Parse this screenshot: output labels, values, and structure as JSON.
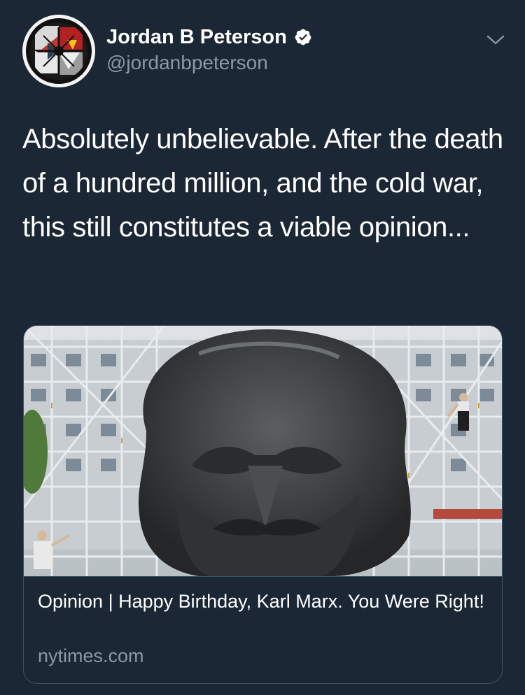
{
  "tweet": {
    "author": {
      "display_name": "Jordan B Peterson",
      "handle": "@jordanbpeterson",
      "verified": true,
      "avatar_icon": "abstract-geometric-avatar-icon"
    },
    "text": "Absolutely unbelievable. After the death of a hundred million, and the cold war, this still constitutes a viable opinion...",
    "menu_icon": "chevron-down-icon"
  },
  "card": {
    "image_alt": "Karl Marx monument head in front of scaffolding",
    "title": "Opinion | Happy Birthday, Karl Marx. You Were Right!",
    "domain": "nytimes.com"
  },
  "colors": {
    "background": "#1b2735",
    "text_primary": "#ffffff",
    "text_secondary": "#8899a6",
    "card_border": "#3d5366",
    "verified_badge": "#ffffff"
  }
}
